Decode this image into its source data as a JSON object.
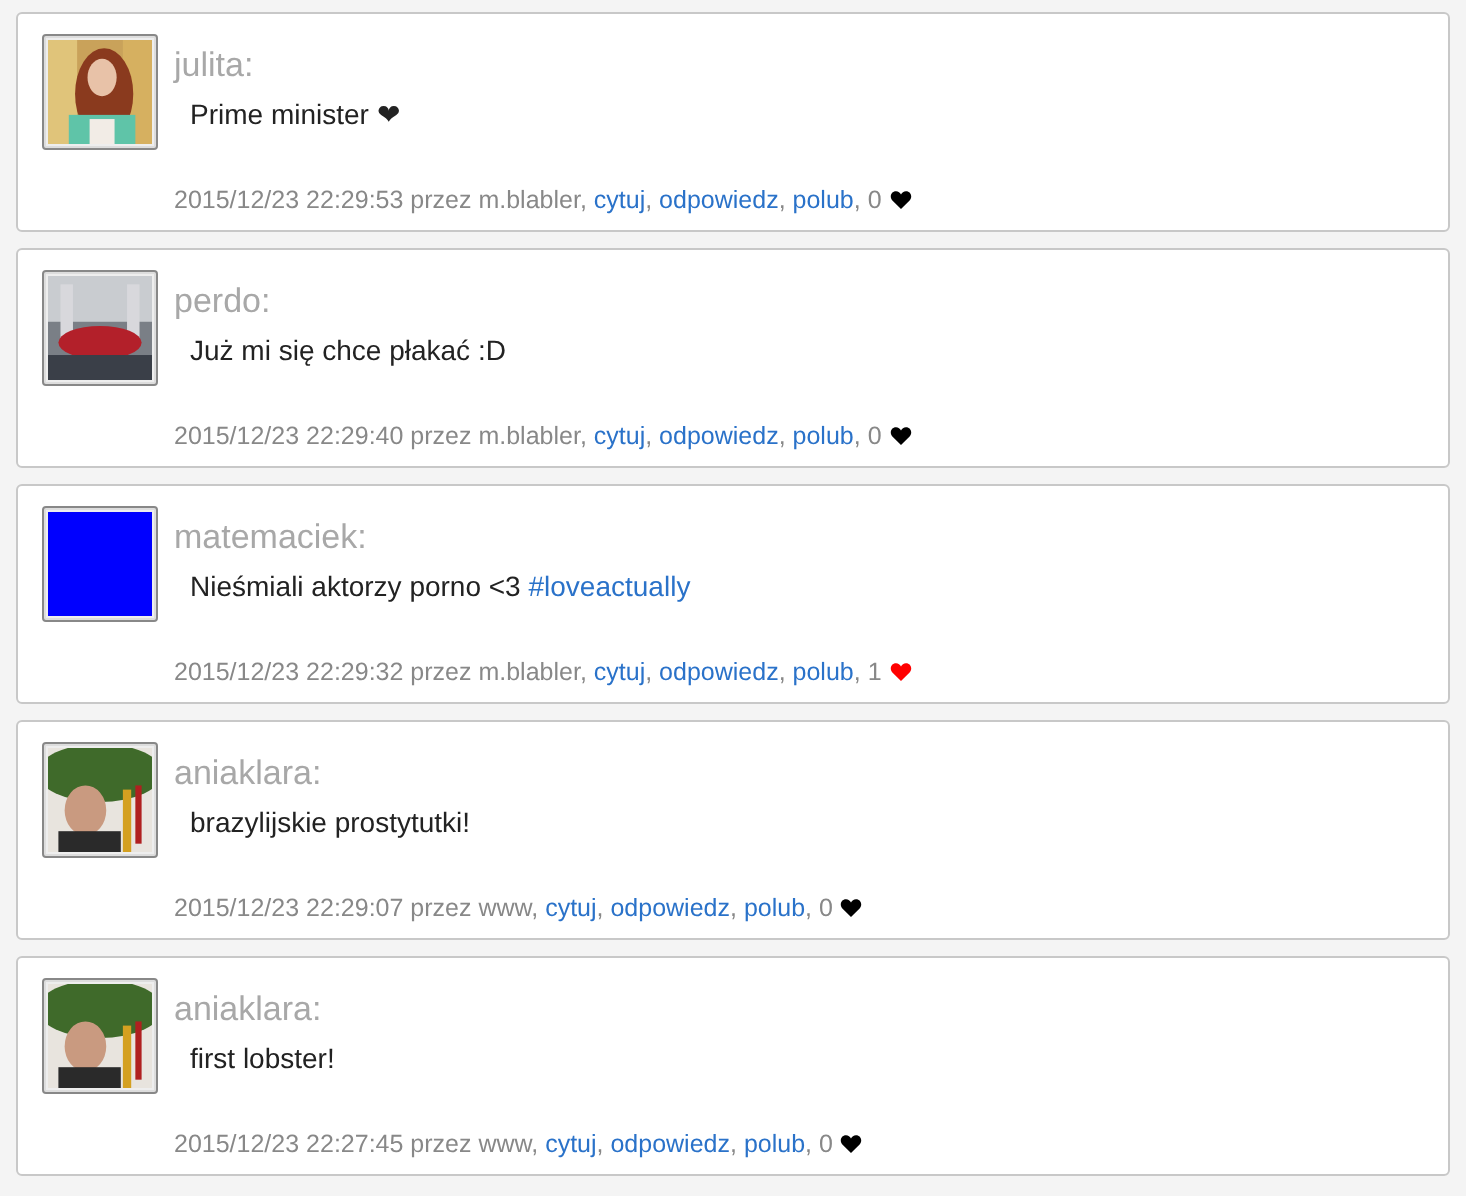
{
  "separator": ", ",
  "posts": [
    {
      "author": "julita:",
      "message": "Prime minister ❤",
      "meta": "2015/12/23 22:29:53 przez m.blabler",
      "actions": [
        "cytuj",
        "odpowiedz",
        "polub"
      ],
      "likes": "0",
      "liked": false
    },
    {
      "author": "perdo:",
      "message": "Już mi się chce płakać :D",
      "meta": "2015/12/23 22:29:40 przez m.blabler",
      "actions": [
        "cytuj",
        "odpowiedz",
        "polub"
      ],
      "likes": "0",
      "liked": false
    },
    {
      "author": "matemaciek:",
      "avatar": {
        "kind": "color",
        "color": "#0000ff"
      },
      "message": "Nieśmiali aktorzy porno <3 ",
      "hashtag": "#loveactually",
      "meta": "2015/12/23 22:29:32 przez m.blabler",
      "actions": [
        "cytuj",
        "odpowiedz",
        "polub"
      ],
      "likes": "1",
      "liked": true
    },
    {
      "author": "aniaklara:",
      "message": "brazylijskie prostytutki!",
      "meta": "2015/12/23 22:29:07 przez www",
      "actions": [
        "cytuj",
        "odpowiedz",
        "polub"
      ],
      "likes": "0",
      "liked": false
    },
    {
      "author": "aniaklara:",
      "message": "first lobster!",
      "meta": "2015/12/23 22:27:45 przez www",
      "actions": [
        "cytuj",
        "odpowiedz",
        "polub"
      ],
      "likes": "0",
      "liked": false
    }
  ]
}
